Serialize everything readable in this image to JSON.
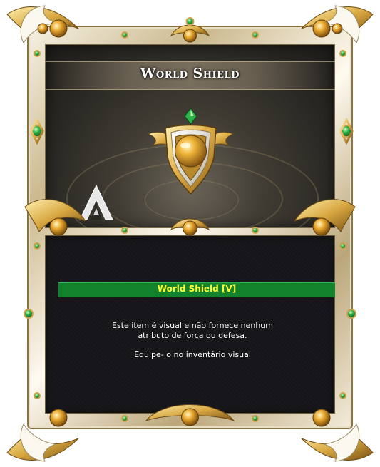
{
  "window": {
    "title": "World Shield"
  },
  "item": {
    "name": "World Shield [V]",
    "description_line1": "Este item é visual e não fornece nenhum",
    "description_line2": "atributo de força ou defesa.",
    "description_line3": "Equipe- o no inventário visual"
  },
  "colors": {
    "item_bar": "#12822c",
    "item_name": "#ffff33",
    "frame_gold": "#c8a24a",
    "gem_green": "#2db34a"
  },
  "icons": {
    "emblem": "winged-shield-emblem-icon",
    "logo": "game-logo-icon",
    "gem": "green-gem-icon",
    "orb": "gold-orb-icon"
  }
}
